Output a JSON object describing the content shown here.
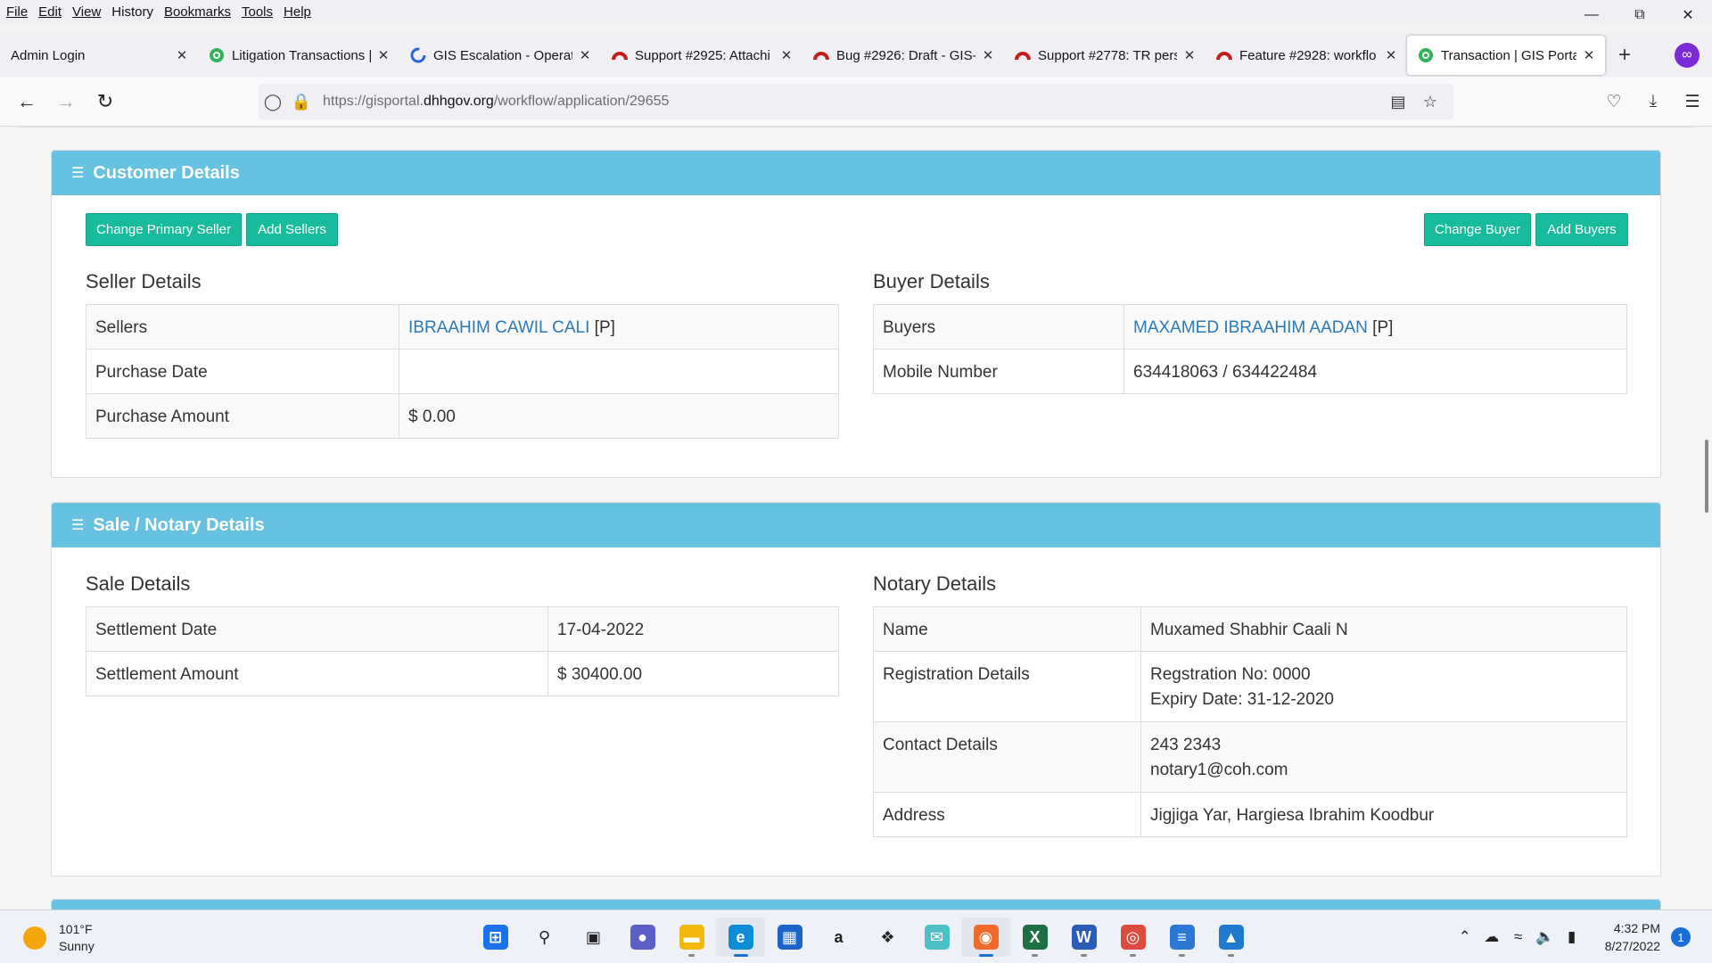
{
  "menu": [
    "File",
    "Edit",
    "View",
    "History",
    "Bookmarks",
    "Tools",
    "Help"
  ],
  "menu_access_keys": [
    "F",
    "E",
    "V",
    "s",
    "B",
    "T",
    "H"
  ],
  "tabs": [
    {
      "label": "Admin Login",
      "favicon": "none",
      "active": false
    },
    {
      "label": "Litigation Transactions |",
      "favicon": "gis-globe-icon",
      "active": false
    },
    {
      "label": "GIS Escalation - Operat",
      "favicon": "loading-icon",
      "active": false
    },
    {
      "label": "Support #2925: Attachi",
      "favicon": "redmine-icon",
      "active": false
    },
    {
      "label": "Bug #2926: Draft - GIS-",
      "favicon": "redmine-icon",
      "active": false
    },
    {
      "label": "Support #2778: TR pers",
      "favicon": "redmine-icon",
      "active": false
    },
    {
      "label": "Feature #2928: workflo",
      "favicon": "redmine-icon",
      "active": false
    },
    {
      "label": "Transaction | GIS Portal",
      "favicon": "gis-globe-icon",
      "active": true
    }
  ],
  "url": {
    "prefix": "https://gisportal.",
    "domain": "dhhgov.org",
    "path": "/workflow/application/29655"
  },
  "customer": {
    "title": "Customer Details",
    "buttons": {
      "change_primary_seller": "Change Primary Seller",
      "add_sellers": "Add Sellers",
      "change_buyer": "Change Buyer",
      "add_buyers": "Add Buyers"
    },
    "seller": {
      "title": "Seller Details",
      "rows": [
        {
          "label": "Sellers",
          "link": "IBRAAHIM CAWIL CALI",
          "suffix": " [P]"
        },
        {
          "label": "Purchase Date",
          "value": ""
        },
        {
          "label": "Purchase Amount",
          "value": "$ 0.00"
        }
      ]
    },
    "buyer": {
      "title": "Buyer Details",
      "rows": [
        {
          "label": "Buyers",
          "link": "MAXAMED IBRAAHIM AADAN",
          "suffix": " [P]"
        },
        {
          "label": "Mobile Number",
          "value": "634418063 / 634422484"
        }
      ]
    }
  },
  "sale": {
    "title": "Sale / Notary Details",
    "sale_details": {
      "title": "Sale Details",
      "rows": [
        {
          "label": "Settlement Date",
          "value": "17-04-2022"
        },
        {
          "label": "Settlement Amount",
          "value": "$ 30400.00"
        }
      ]
    },
    "notary_details": {
      "title": "Notary Details",
      "rows": [
        {
          "label": "Name",
          "value": "Muxamed Shabhir Caali N"
        },
        {
          "label": "Registration Details",
          "value": "Regstration No: 0000",
          "value2": "Expiry Date: 31-12-2020"
        },
        {
          "label": "Contact Details",
          "value": "243 2343",
          "value2": "notary1@coh.com"
        },
        {
          "label": "Address",
          "value": "Jigjiga Yar, Hargiesa Ibrahim Koodbur"
        }
      ]
    }
  },
  "taskbar": {
    "weather": {
      "temp": "101°F",
      "condition": "Sunny"
    },
    "apps": [
      {
        "name": "start-icon",
        "color": "#1a73e8"
      },
      {
        "name": "search-icon",
        "color": "#222222"
      },
      {
        "name": "task-view-icon",
        "color": "#222222"
      },
      {
        "name": "teams-chat-icon",
        "color": "#5b5fc7"
      },
      {
        "name": "file-explorer-icon",
        "color": "#f2b90c"
      },
      {
        "name": "edge-icon",
        "color": "#0c8dd6"
      },
      {
        "name": "store-icon",
        "color": "#1c64c8"
      },
      {
        "name": "amazon-icon",
        "color": "#222222"
      },
      {
        "name": "dropbox-icon",
        "color": "#222222"
      },
      {
        "name": "messenger-icon",
        "color": "#4cc0c8"
      },
      {
        "name": "firefox-icon",
        "color": "#f06a2a"
      },
      {
        "name": "excel-icon",
        "color": "#1d7044"
      },
      {
        "name": "word-icon",
        "color": "#2b5bb8"
      },
      {
        "name": "chrome-icon",
        "color": "#dd4b3e"
      },
      {
        "name": "notepad-icon",
        "color": "#2b78d6"
      },
      {
        "name": "photos-icon",
        "color": "#1f7ad0"
      }
    ],
    "clock": {
      "time": "4:32 PM",
      "date": "8/27/2022"
    },
    "notifications": "1"
  },
  "colors": {
    "panel_header": "#67c1e0",
    "button_green": "#18bc9c",
    "link": "#2a7ab9"
  }
}
